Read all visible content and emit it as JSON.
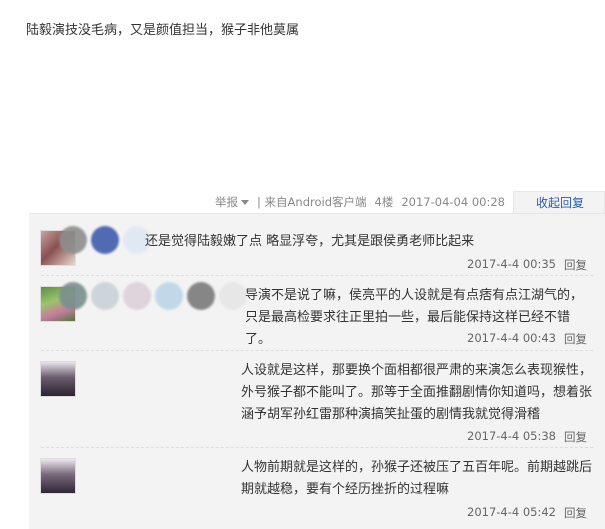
{
  "post": {
    "text": "陆毅演技没毛病，又是颜值担当，猴子非他莫属"
  },
  "meta": {
    "report_label": "举报",
    "source": "| 来自Android客户端",
    "floor": "4楼",
    "timestamp": "2017-04-04 00:28",
    "collapse_label": "收起回复"
  },
  "replies": [
    {
      "text": "还是觉得陆毅嫩了点 略显浮夸，尤其是跟侯勇老师比起来",
      "time": "2017-4-4 00:35",
      "reply_label": "回复"
    },
    {
      "text": "导演不是说了嘛，侯亮平的人设就是有点痞有点江湖气的，只是最高检要求往正里拍一些，最后能保持这样已经不错了。",
      "time": "2017-4-4 00:43",
      "reply_label": "回复"
    },
    {
      "text": "人设就是这样，那要换个面相都很严肃的来演怎么表现猴性，外号猴子都不能叫了。那等于全面推翻剧情你知道吗，想着张涵予胡军孙红雷那种演搞笑扯蛋的剧情我就觉得滑稽",
      "time": "2017-4-4 05:38",
      "reply_label": "回复"
    },
    {
      "text": "人物前期就是这样的，孙猴子还被压了五百年呢。前期越跳后期就越稳，要有个经历挫折的过程嘛",
      "time": "2017-4-4 05:42",
      "reply_label": "回复"
    }
  ]
}
